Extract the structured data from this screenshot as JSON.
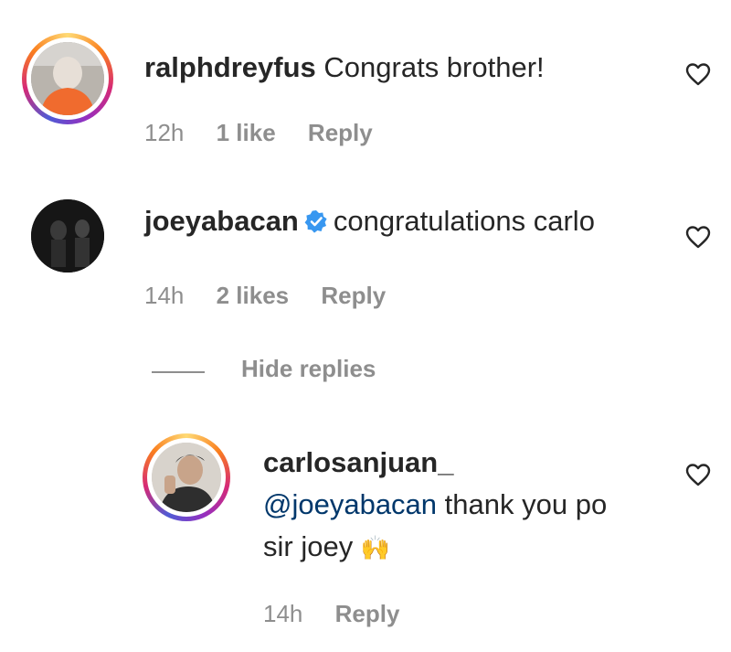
{
  "comments": [
    {
      "username": "ralphdreyfus",
      "text": "Congrats brother!",
      "time": "12h",
      "likes": "1 like",
      "reply_label": "Reply",
      "has_story_ring": true
    },
    {
      "username": "joeyabacan",
      "verified": true,
      "text": "congratulations carlo",
      "time": "14h",
      "likes": "2 likes",
      "reply_label": "Reply",
      "has_story_ring": false
    }
  ],
  "hide_replies_label": "Hide replies",
  "reply": {
    "username": "carlosanjuan_",
    "mention": "@joeyabacan",
    "text_line1_rest": " thank you po",
    "text_line2": "sir joey",
    "emoji": "🙌",
    "time": "14h",
    "reply_label": "Reply",
    "has_story_ring": true
  },
  "colors": {
    "text": "#262626",
    "meta": "#8e8e8e",
    "mention": "#00376b",
    "verified": "#3897f0"
  },
  "icons": [
    "heart-icon",
    "verified-badge-icon"
  ]
}
